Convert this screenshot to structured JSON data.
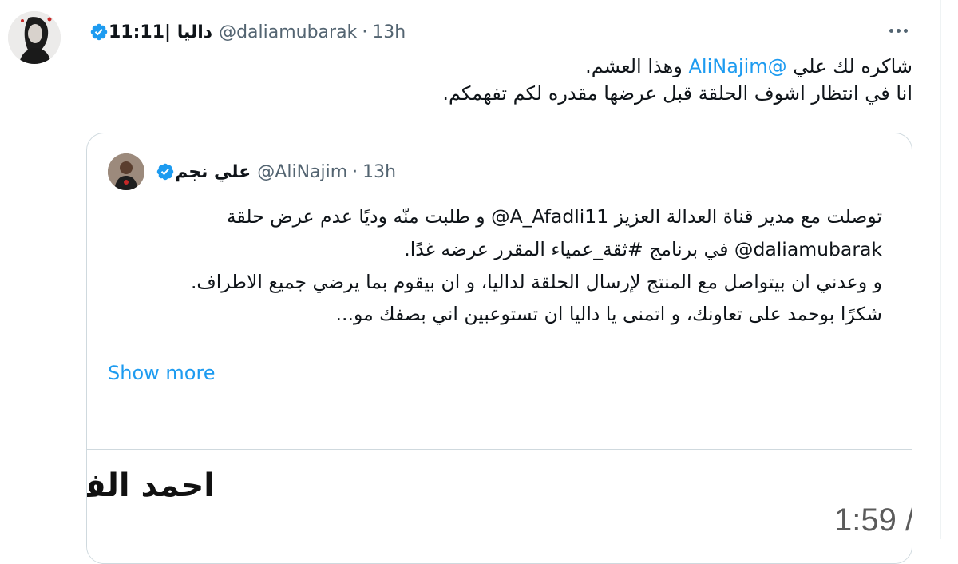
{
  "tweet": {
    "display_name": "داليا |11:11",
    "handle": "@daliamubarak",
    "separator": "·",
    "time": "13h",
    "text_line1_before": "شاكره لك علي ",
    "text_line1_mention": "@AliNajim",
    "text_line1_after": " وهذا العشم.",
    "text_line2": "انا في انتظار اشوف الحلقة قبل عرضها مقدره لكم تفهمكم."
  },
  "quoted": {
    "display_name": "علي نجم",
    "handle": "@AliNajim",
    "separator": "·",
    "time": "13h",
    "p1": "توصلت مع مدير قناة العدالة العزيز A_Afadli11@ و طلبت منّه وديًا عدم عرض حلقة daliamubarak@ في برنامج #ثقة_عمياء المقرر عرضه غدًا.",
    "p2": "و وعدني ان بيتواصل مع المنتج لإرسال الحلقة لداليا، و ان بيقوم بما يرضي جميع الاطراف.",
    "p3": "شكرًا بوحمد على تعاونك، و اتمنى يا داليا ان تستوعبين اني بصفك مو...",
    "show_more": "Show more",
    "media_title": "احمد الف",
    "media_clock": "1:59 /"
  },
  "icons": {
    "verified": "verified-badge-icon",
    "more": "more-horizontal-icon"
  },
  "colors": {
    "link": "#1d9bf0",
    "secondary_text": "#536471",
    "border": "#cfd9de"
  }
}
